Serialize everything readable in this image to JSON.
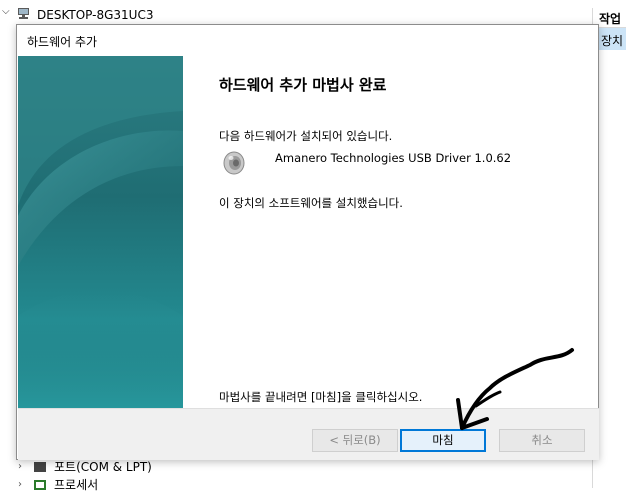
{
  "background": {
    "tree_root": "DESKTOP-8G31UC3",
    "action_pane_header": "작업",
    "action_pane_item": "장치",
    "tree_items": [
      "포트(COM & LPT)",
      "프로세서"
    ]
  },
  "dialog": {
    "title": "하드웨어 추가",
    "heading": "하드웨어 추가 마법사 완료",
    "installed_intro": "다음 하드웨어가 설치되어 있습니다.",
    "device_name": "Amanero Technologies USB Driver 1.0.62",
    "installed_message": "이 장치의 소프트웨어를 설치했습니다.",
    "finish_instruction": "마법사를 끝내려면 [마침]을 클릭하십시오.",
    "buttons": {
      "back": "< 뒤로(B)",
      "finish": "마침",
      "cancel": "취소"
    }
  },
  "icons": {
    "device_icon": "speaker-icon",
    "tree_root_icon": "computer-icon"
  },
  "colors": {
    "side_panel": "#1f6d73",
    "finish_border": "#0078d7",
    "annotation_arrow": "#000000"
  }
}
